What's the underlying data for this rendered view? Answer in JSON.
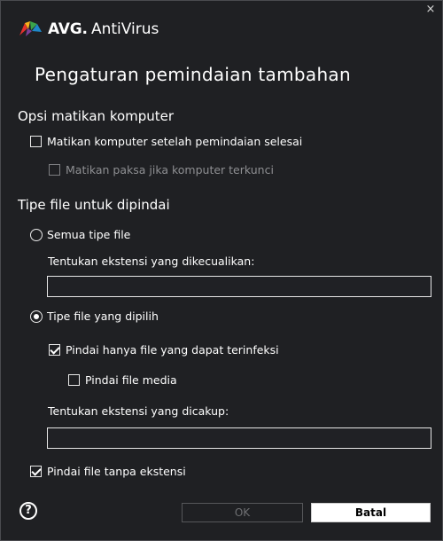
{
  "window": {
    "close_glyph": "×"
  },
  "brand": {
    "name": "AVG",
    "dot": ".",
    "product": "AntiVirus",
    "icon": "avg-logo-icon"
  },
  "title": "Pengaturan pemindaian tambahan",
  "shutdown": {
    "heading": "Opsi matikan komputer",
    "shutdown_after_scan": {
      "label": "Matikan komputer setelah pemindaian selesai",
      "checked": false
    },
    "force_shutdown": {
      "label": "Matikan paksa jika komputer terkunci",
      "checked": false,
      "disabled": true
    }
  },
  "file_types": {
    "heading": "Tipe file untuk dipindai",
    "all_types": {
      "label": "Semua tipe file",
      "selected": false
    },
    "exclude_label": "Tentukan ekstensi yang dikecualikan:",
    "exclude_value": "",
    "selected_types": {
      "label": "Tipe file yang dipilih",
      "selected": true
    },
    "infectable_only": {
      "label": "Pindai hanya file yang dapat terinfeksi",
      "checked": true
    },
    "media_files": {
      "label": "Pindai file media",
      "checked": false
    },
    "include_label": "Tentukan ekstensi yang dicakup:",
    "include_value": "",
    "no_extension": {
      "label": "Pindai file tanpa ekstensi",
      "checked": true
    }
  },
  "footer": {
    "help_glyph": "?",
    "ok_label": "OK",
    "cancel_label": "Batal"
  },
  "colors": {
    "background": "#1f2023",
    "text": "#ffffff",
    "disabled_text": "#8e8f92",
    "button_bg": "#ffffff"
  }
}
